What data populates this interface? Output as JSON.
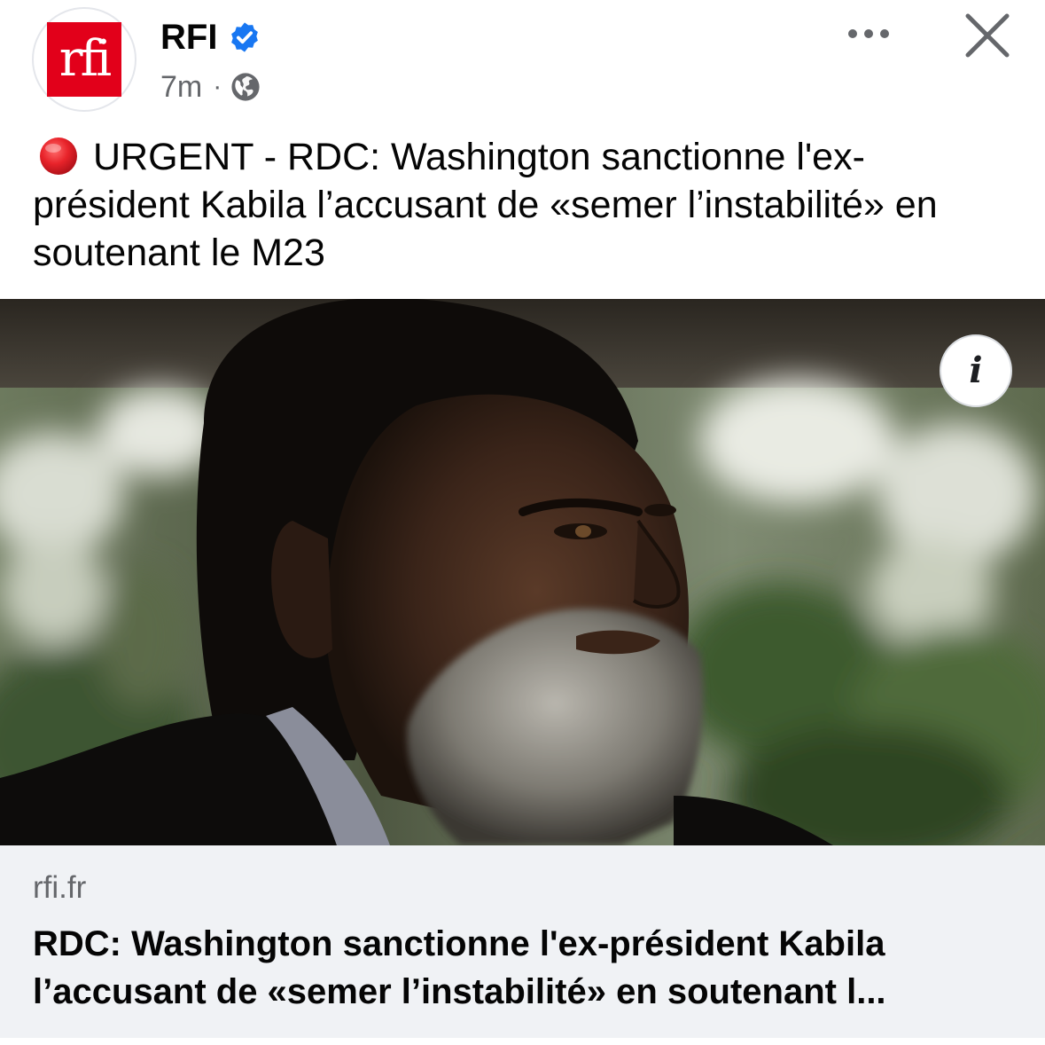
{
  "post": {
    "page_name": "RFI",
    "avatar_text": "rfi",
    "time_ago": "7m",
    "meta_separator": "·",
    "text": "URGENT - RDC: Washington sanctionne l'ex-président Kabila l’accusant de «semer l’instabilité» en soutenant le M23"
  },
  "link_preview": {
    "domain": "rfi.fr",
    "title": "RDC: Washington sanctionne l'ex-président Kabila l’accusant de «semer l’instabilité» en soutenant l..."
  },
  "info_button": {
    "glyph": "i"
  },
  "icons": {
    "verified": "verified-badge-icon",
    "globe": "globe-icon",
    "more": "more-horizontal-icon",
    "close": "close-icon",
    "urgent": "red-circle-icon",
    "info": "info-icon"
  },
  "colors": {
    "brand_red": "#e2001a",
    "verified_blue": "#1877f2",
    "secondary_text": "#65676b",
    "preview_background": "#f0f2f5"
  }
}
